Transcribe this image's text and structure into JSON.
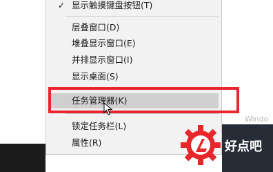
{
  "menu": {
    "items": [
      {
        "label": "显示触摸键盘按钮(T)",
        "checked": true
      },
      {
        "label": "层叠窗口(D)"
      },
      {
        "label": "堆叠显示窗口(E)"
      },
      {
        "label": "并排显示窗口(I)"
      },
      {
        "label": "显示桌面(S)"
      },
      {
        "label": "任务管理器(K)",
        "hovered": true
      },
      {
        "label": "锁定任务栏(L)"
      },
      {
        "label": "属性(R)"
      }
    ],
    "check_glyph": "✓"
  },
  "watermark": {
    "text": "Windo"
  },
  "logo": {
    "text": "好点吧",
    "gear_color": "#e8262c",
    "accent_color": "#e8262c"
  },
  "colors": {
    "highlight_border": "#e8262c",
    "menu_bg": "#f2f2f2",
    "hover_bg": "#cfcfcf"
  }
}
